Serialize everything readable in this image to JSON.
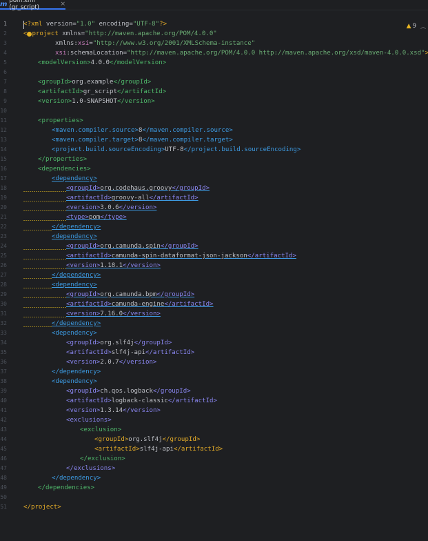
{
  "tab": {
    "icon": "m",
    "title": "pom.xml (gr_script)",
    "close": "×"
  },
  "inspections": {
    "count": "9"
  },
  "lines": [
    {
      "n": "1"
    },
    {
      "n": "2"
    },
    {
      "n": "3"
    },
    {
      "n": "4"
    },
    {
      "n": "5"
    },
    {
      "n": "6"
    },
    {
      "n": "7"
    },
    {
      "n": "8"
    },
    {
      "n": "9"
    },
    {
      "n": "10"
    },
    {
      "n": "11"
    },
    {
      "n": "12"
    },
    {
      "n": "13"
    },
    {
      "n": "14"
    },
    {
      "n": "15"
    },
    {
      "n": "16"
    },
    {
      "n": "17"
    },
    {
      "n": "18"
    },
    {
      "n": "19"
    },
    {
      "n": "20"
    },
    {
      "n": "21"
    },
    {
      "n": "22"
    },
    {
      "n": "23"
    },
    {
      "n": "24"
    },
    {
      "n": "25"
    },
    {
      "n": "26"
    },
    {
      "n": "27"
    },
    {
      "n": "28"
    },
    {
      "n": "29"
    },
    {
      "n": "30"
    },
    {
      "n": "31"
    },
    {
      "n": "32"
    },
    {
      "n": "33"
    },
    {
      "n": "34"
    },
    {
      "n": "35"
    },
    {
      "n": "36"
    },
    {
      "n": "37"
    },
    {
      "n": "38"
    },
    {
      "n": "39"
    },
    {
      "n": "40"
    },
    {
      "n": "41"
    },
    {
      "n": "42"
    },
    {
      "n": "43"
    },
    {
      "n": "44"
    },
    {
      "n": "45"
    },
    {
      "n": "46"
    },
    {
      "n": "47"
    },
    {
      "n": "48"
    },
    {
      "n": "49"
    },
    {
      "n": "50"
    },
    {
      "n": "51"
    }
  ],
  "code": {
    "l1": {
      "open": "<?xml ",
      "a1": "version",
      "eq1": "=",
      "v1": "\"1.0\"",
      "a2": " encoding",
      "eq2": "=",
      "v2": "\"UTF-8\"",
      "close": "?>"
    },
    "l2": {
      "open": "<",
      "tag": "project",
      "a1": " xmlns",
      "eq": "=",
      "v1": "\"http://maven.apache.org/POM/4.0.0\""
    },
    "l3": {
      "a1": "xmlns:",
      "ns": "xsi",
      "eq": "=",
      "v1": "\"http://www.w3.org/2001/XMLSchema-instance\""
    },
    "l4": {
      "ns": "xsi",
      "a1": ":schemaLocation",
      "eq": "=",
      "v1": "\"http://maven.apache.org/POM/4.0.0 http://maven.apache.org/xsd/maven-4.0.0.xsd\"",
      "close": ">"
    },
    "l5": {
      "open": "<modelVersion>",
      "text": "4.0.0",
      "close": "</modelVersion>"
    },
    "l7": {
      "open": "<groupId>",
      "text": "org.example",
      "close": "</groupId>"
    },
    "l8": {
      "open": "<artifactId>",
      "text": "gr_script",
      "close": "</artifactId>"
    },
    "l9": {
      "open": "<version>",
      "text": "1.0-SNAPSHOT",
      "close": "</version>"
    },
    "l11": {
      "open": "<properties>"
    },
    "l12": {
      "open": "<maven.compiler.source>",
      "text": "8",
      "close": "</maven.compiler.source>"
    },
    "l13": {
      "open": "<maven.compiler.target>",
      "text": "8",
      "close": "</maven.compiler.target>"
    },
    "l14": {
      "open": "<project.build.sourceEncoding>",
      "text": "UTF-8",
      "close": "</project.build.sourceEncoding>"
    },
    "l15": {
      "close": "</properties>"
    },
    "l16": {
      "open": "<dependencies>"
    },
    "l17": {
      "open": "<dependency>"
    },
    "l18": {
      "open": "<groupId>",
      "text": "org.codehaus.groovy",
      "close": "</groupId>"
    },
    "l19": {
      "open": "<artifactId>",
      "text": "groovy-all",
      "close": "</artifactId>"
    },
    "l20": {
      "open": "<version>",
      "text": "3.0.6",
      "close": "</version>"
    },
    "l21": {
      "open": "<type>",
      "text": "pom",
      "close": "</type>"
    },
    "l22": {
      "close": "</dependency>"
    },
    "l23": {
      "open": "<dependency>"
    },
    "l24": {
      "open": "<groupId>",
      "text": "org.camunda.spin",
      "close": "</groupId>"
    },
    "l25": {
      "open": "<artifactId>",
      "text": "camunda-spin-dataformat-json-jackson",
      "close": "</artifactId>"
    },
    "l26": {
      "open": "<version>",
      "text": "1.18.1",
      "close": "</version>"
    },
    "l27": {
      "close": "</dependency>"
    },
    "l28": {
      "open": "<dependency>"
    },
    "l29": {
      "open": "<groupId>",
      "text": "org.camunda.bpm",
      "close": "</groupId>"
    },
    "l30": {
      "open": "<artifactId>",
      "text": "camunda-engine",
      "close": "</artifactId>"
    },
    "l31": {
      "open": "<version>",
      "text": "7.16.0",
      "close": "</version>"
    },
    "l32": {
      "close": "</dependency>"
    },
    "l33": {
      "open": "<dependency>"
    },
    "l34": {
      "open": "<groupId>",
      "text": "org.slf4j",
      "close": "</groupId>"
    },
    "l35": {
      "open": "<artifactId>",
      "text": "slf4j-api",
      "close": "</artifactId>"
    },
    "l36": {
      "open": "<version>",
      "text": "2.0.7",
      "close": "</version>"
    },
    "l37": {
      "close": "</dependency>"
    },
    "l38": {
      "open": "<dependency>"
    },
    "l39": {
      "open": "<groupId>",
      "text": "ch.qos.logback",
      "close": "</groupId>"
    },
    "l40": {
      "open": "<artifactId>",
      "text": "logback-classic",
      "close": "</artifactId>"
    },
    "l41": {
      "open": "<version>",
      "text": "1.3.14",
      "close": "</version>"
    },
    "l42": {
      "open": "<exclusions>"
    },
    "l43": {
      "open": "<exclusion>"
    },
    "l44": {
      "open": "<groupId>",
      "text": "org.slf4j",
      "close": "</groupId>"
    },
    "l45": {
      "open": "<artifactId>",
      "text": "slf4j-api",
      "close": "</artifactId>"
    },
    "l46": {
      "close": "</exclusion>"
    },
    "l47": {
      "close": "</exclusions>"
    },
    "l48": {
      "close": "</dependency>"
    },
    "l49": {
      "close": "</dependencies>"
    },
    "l51": {
      "close": "</project>"
    }
  },
  "colors": {
    "background": "#1e1f22",
    "tag_green": "#4fb76a",
    "tag_yellow": "#e0a928",
    "tag_blue": "#3d9be3",
    "string": "#6aab73",
    "accent": "#3574f0"
  }
}
